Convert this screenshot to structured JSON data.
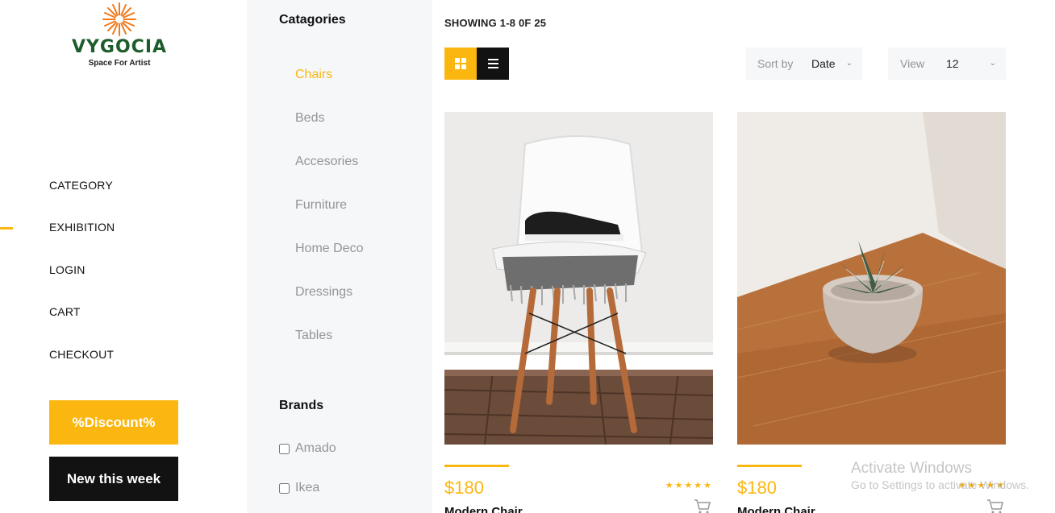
{
  "brand": {
    "name": "VYGOCIA",
    "tagline": "Space For Artist"
  },
  "nav": {
    "items": [
      {
        "label": "CATEGORY"
      },
      {
        "label": "EXHIBITION",
        "active": true
      },
      {
        "label": "LOGIN"
      },
      {
        "label": "CART"
      },
      {
        "label": "CHECKOUT"
      }
    ],
    "discount_label": "%Discount%",
    "new_label": "New this week"
  },
  "categories": {
    "title": "Catagories",
    "items": [
      {
        "label": "Chairs",
        "active": true
      },
      {
        "label": "Beds"
      },
      {
        "label": "Accesories"
      },
      {
        "label": "Furniture"
      },
      {
        "label": "Home Deco"
      },
      {
        "label": "Dressings"
      },
      {
        "label": "Tables"
      }
    ]
  },
  "brands": {
    "title": "Brands",
    "items": [
      {
        "label": "Amado",
        "checked": false
      },
      {
        "label": "Ikea",
        "checked": false
      }
    ]
  },
  "toolbar": {
    "showing": "SHOWING 1-8 0F 25",
    "sort_label": "Sort by",
    "sort_value": "Date",
    "view_label": "View",
    "view_value": "12"
  },
  "products": [
    {
      "price": "$180",
      "name": "Modern Chair",
      "rating": 5,
      "image": "white-chair-with-shoes-photo"
    },
    {
      "price": "$180",
      "name": "Modern Chair",
      "rating": 5,
      "image": "succulent-pot-on-table-photo"
    }
  ],
  "watermark": {
    "title": "Activate Windows",
    "subtitle": "Go to Settings to activate Windows."
  },
  "colors": {
    "accent": "#fbb710",
    "dark": "#131212",
    "sidebar_bg": "#f5f7f9",
    "muted": "#959595",
    "logo_green": "#1d5c2b",
    "logo_orange": "#f07a1c"
  }
}
